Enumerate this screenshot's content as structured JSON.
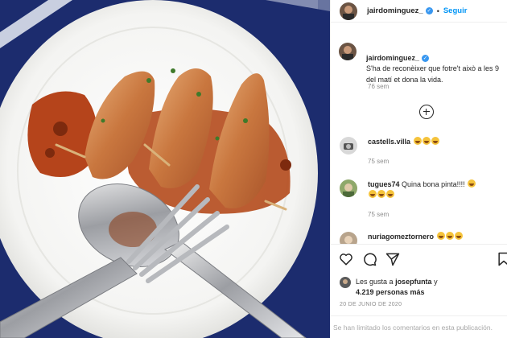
{
  "post": {
    "author": "jairdominguez_",
    "follow_label": "Seguir",
    "separator": "•",
    "caption": "S'ha de reconèixer que fotre't això a les 9 del matí et dona la vida.",
    "caption_time": "76 sem",
    "image_icon": "photo-of-stuffed-squid-on-plate"
  },
  "comments": [
    {
      "user": "castells.villa",
      "text": "",
      "emoji_count": 3,
      "time": "75 sem"
    },
    {
      "user": "tugues74",
      "text": "Quina bona pinta!!!!",
      "emoji_count": 4,
      "time": "75 sem"
    },
    {
      "user": "nuriagomeztornero",
      "text": "",
      "emoji_count": 3,
      "time": ""
    }
  ],
  "actions": {
    "like_icon": "heart-icon",
    "comment_icon": "comment-icon",
    "share_icon": "share-icon",
    "save_icon": "bookmark-icon",
    "likes_prefix": "Les gusta a",
    "likes_user": "josepfunta",
    "likes_and": "y",
    "likes_count": "4.219 personas más",
    "date": "20 DE JUNIO DE 2020",
    "comments_disabled": "Se han limitado los comentarios en esta publicación."
  },
  "colors": {
    "link": "#0095f6",
    "verified": "#3897f0",
    "muted": "#8e8e8e",
    "plate_background": "#1c2c6e"
  }
}
